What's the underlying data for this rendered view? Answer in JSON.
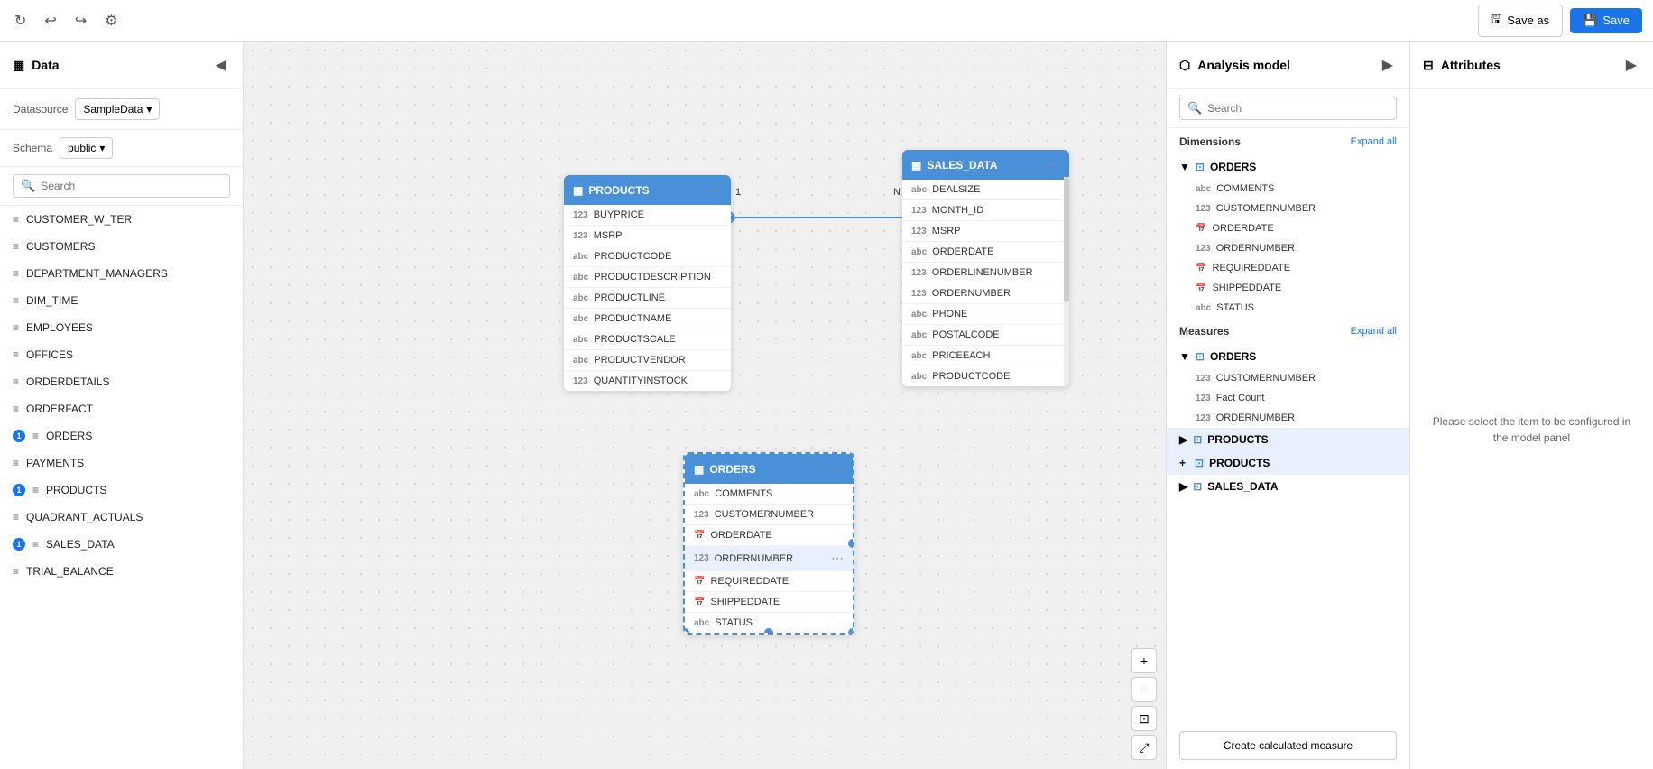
{
  "topbar": {
    "save_as_label": "Save as",
    "save_label": "Save",
    "settings_icon": "⚙",
    "undo_icon": "↩",
    "redo_icon": "↪",
    "refresh_icon": "↻"
  },
  "left_panel": {
    "title": "Data",
    "collapse_icon": "◀",
    "datasource_label": "Datasource",
    "datasource_value": "SampleData",
    "schema_label": "Schema",
    "schema_value": "public",
    "search_placeholder": "Search",
    "tables": [
      {
        "name": "CUSTOMER_W_TER",
        "badge": false
      },
      {
        "name": "CUSTOMERS",
        "badge": false
      },
      {
        "name": "DEPARTMENT_MANAGERS",
        "badge": false
      },
      {
        "name": "DIM_TIME",
        "badge": false
      },
      {
        "name": "EMPLOYEES",
        "badge": false
      },
      {
        "name": "OFFICES",
        "badge": false
      },
      {
        "name": "ORDERDETAILS",
        "badge": false
      },
      {
        "name": "ORDERFACT",
        "badge": false
      },
      {
        "name": "ORDERS",
        "badge": true,
        "badge_value": "1"
      },
      {
        "name": "PAYMENTS",
        "badge": false
      },
      {
        "name": "PRODUCTS",
        "badge": true,
        "badge_value": "1"
      },
      {
        "name": "QUADRANT_ACTUALS",
        "badge": false
      },
      {
        "name": "SALES_DATA",
        "badge": true,
        "badge_value": "1"
      },
      {
        "name": "TRIAL_BALANCE",
        "badge": false
      }
    ]
  },
  "canvas": {
    "products_card": {
      "title": "PRODUCTS",
      "fields": [
        {
          "type": "123",
          "name": "BUYPRICE"
        },
        {
          "type": "123",
          "name": "MSRP"
        },
        {
          "type": "abc",
          "name": "PRODUCTCODE"
        },
        {
          "type": "abc",
          "name": "PRODUCTDESCRIPTION"
        },
        {
          "type": "abc",
          "name": "PRODUCTLINE"
        },
        {
          "type": "abc",
          "name": "PRODUCTNAME"
        },
        {
          "type": "abc",
          "name": "PRODUCTSCALE"
        },
        {
          "type": "abc",
          "name": "PRODUCTVENDOR"
        },
        {
          "type": "123",
          "name": "QUANTITYINSTOCK"
        }
      ]
    },
    "sales_data_card": {
      "title": "SALES_DATA",
      "fields": [
        {
          "type": "abc",
          "name": "DEALSIZE"
        },
        {
          "type": "123",
          "name": "MONTH_ID"
        },
        {
          "type": "123",
          "name": "MSRP"
        },
        {
          "type": "abc",
          "name": "ORDERDATE"
        },
        {
          "type": "123",
          "name": "ORDERLINENUMBER"
        },
        {
          "type": "123",
          "name": "ORDERNUMBER"
        },
        {
          "type": "abc",
          "name": "PHONE"
        },
        {
          "type": "abc",
          "name": "POSTALCODE"
        },
        {
          "type": "abc",
          "name": "PRICEEACH"
        },
        {
          "type": "abc",
          "name": "PRODUCTCODE"
        }
      ]
    },
    "orders_card": {
      "title": "ORDERS",
      "fields": [
        {
          "type": "abc",
          "name": "COMMENTS"
        },
        {
          "type": "123",
          "name": "CUSTOMERNUMBER"
        },
        {
          "type": "cal",
          "name": "ORDERDATE"
        },
        {
          "type": "123",
          "name": "ORDERNUMBER",
          "highlighted": true
        },
        {
          "type": "cal",
          "name": "REQUIREDDATE"
        },
        {
          "type": "cal",
          "name": "SHIPPEDDATE"
        },
        {
          "type": "abc",
          "name": "STATUS"
        }
      ]
    }
  },
  "analysis_panel": {
    "title": "Analysis model",
    "collapse_icon": "▶",
    "search_placeholder": "Search",
    "dimensions_label": "Dimensions",
    "expand_all_label": "Expand all",
    "measures_label": "Measures",
    "dimensions_tree": [
      {
        "group": "ORDERS",
        "items": [
          {
            "type": "abc",
            "name": "COMMENTS"
          },
          {
            "type": "123",
            "name": "CUSTOMERNUMBER"
          },
          {
            "type": "cal",
            "name": "ORDERDATE"
          },
          {
            "type": "123",
            "name": "ORDERNUMBER"
          },
          {
            "type": "cal",
            "name": "REQUIREDDATE"
          },
          {
            "type": "cal",
            "name": "SHIPPEDDATE"
          },
          {
            "type": "abc",
            "name": "STATUS"
          }
        ]
      }
    ],
    "measures_tree": [
      {
        "group": "ORDERS",
        "items": [
          {
            "type": "123",
            "name": "CUSTOMERNUMBER"
          },
          {
            "type": "123",
            "name": "Fact Count"
          },
          {
            "type": "123",
            "name": "ORDERNUMBER"
          }
        ]
      },
      {
        "group": "PRODUCTS",
        "items": [],
        "selected": true
      },
      {
        "group": "SALES_DATA",
        "items": []
      }
    ],
    "create_btn_label": "Create calculated measure"
  },
  "attributes_panel": {
    "title": "Attributes",
    "collapse_icon": "▶",
    "message": "Please select the item to be configured in the model panel"
  }
}
